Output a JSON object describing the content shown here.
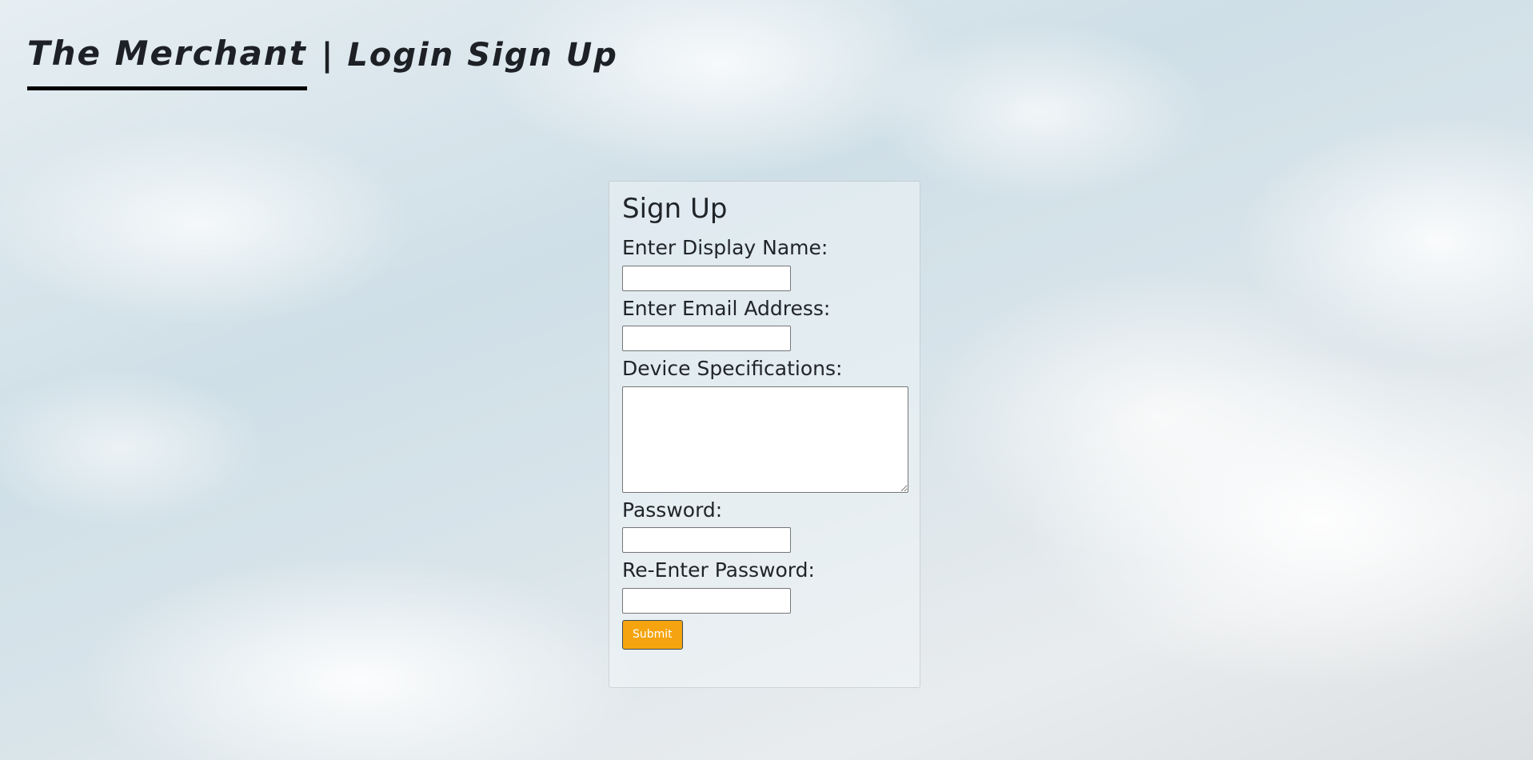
{
  "header": {
    "brand": "The Merchant",
    "separator": "|",
    "nav": {
      "login": "Login",
      "signup": "Sign Up"
    }
  },
  "form": {
    "title": "Sign Up",
    "display_name_label": "Enter Display Name:",
    "display_name_value": "",
    "email_label": "Enter Email Address:",
    "email_value": "",
    "device_specs_label": "Device Specifications:",
    "device_specs_value": "",
    "password_label": "Password:",
    "password_value": "",
    "reenter_password_label": "Re-Enter Password:",
    "reenter_password_value": "",
    "submit_label": "Submit"
  },
  "colors": {
    "submit_button": "#f5a40f",
    "brand_underline": "#000000"
  }
}
